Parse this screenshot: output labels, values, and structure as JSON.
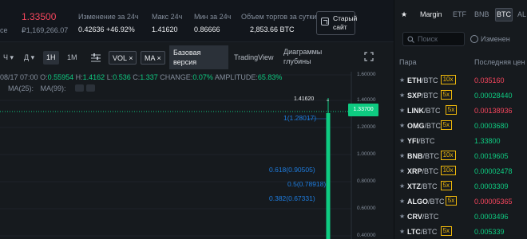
{
  "ticker": {
    "last_price": "1.33500",
    "fiat_price": "₽1,169,266.07",
    "pair_suffix": "ce",
    "change_label": "Изменение за 24ч",
    "change_value": "0.42636 +46.92%",
    "high_label": "Макс 24ч",
    "high_value": "1.41620",
    "low_label": "Мин за 24ч",
    "low_value": "0.86666",
    "volume_label": "Объем торгов за сутки",
    "volume_value": "2,853.66 BTC",
    "old_site_label_1": "Старый",
    "old_site_label_2": "сайт"
  },
  "toolbar": {
    "hours_label": "Ч",
    "days_label": "Д",
    "interval_1h": "1H",
    "interval_1m": "1M",
    "vol_label": "VOL",
    "ma_label": "MA",
    "close_glyph": "×",
    "dropdown_glyph": "▾",
    "base_version_1": "Базовая",
    "base_version_2": "версия",
    "tradingview_label": "TradingView",
    "depth_label_1": "Диаграммы",
    "depth_label_2": "глубины"
  },
  "chart": {
    "ohlc_date": "08/17 07:00",
    "o_label": "O:",
    "o_value": "0.55954",
    "h_label": "H:",
    "h_value": "1.4162",
    "l_label": "L:",
    "l_value": "0.536",
    "c_label": "C:",
    "c_value": "1.337",
    "change_label": "CHANGE:",
    "change_value": "0.07%",
    "amp_label": "AMPLITUDE:",
    "amp_value": "65.83%",
    "ma25_label": "MA(25):",
    "ma99_label": "MA(99):",
    "high_marker": "1.41620",
    "current_price_tag": "1.33700",
    "fib_1": "1(1.28017)",
    "fib_0618": "0.618(0.90505)",
    "fib_05": "0.5(0.78918)",
    "fib_0382": "0.382(0.67331)",
    "axis": [
      "1.60000",
      "1.40000",
      "1.20000",
      "1.00000",
      "0.80000",
      "0.60000",
      "0.40000"
    ]
  },
  "right_panel": {
    "star_glyph": "★",
    "tab_margin": "Margin",
    "tab_etf": "ETF",
    "tab_bnb": "BNB",
    "tab_btc": "BTC",
    "tab_alt": "AL",
    "search_placeholder": "Поиск",
    "change_toggle_label": "Изменен",
    "col_pair": "Пара",
    "col_price": "Последняя цен",
    "rows": [
      {
        "base": "ETH",
        "quote": "/BTC",
        "lev": "10x",
        "price": "0.035160",
        "color": "#f6465d"
      },
      {
        "base": "SXP",
        "quote": "/BTC",
        "lev": "5x",
        "price": "0.00028440",
        "color": "#0ecb81"
      },
      {
        "base": "LINK",
        "quote": "/BTC",
        "lev": "5x",
        "price": "0.00138936",
        "color": "#f6465d"
      },
      {
        "base": "OMG",
        "quote": "/BTC",
        "lev": "5x",
        "price": "0.0003680",
        "color": "#0ecb81"
      },
      {
        "base": "YFI",
        "quote": "/BTC",
        "lev": "",
        "price": "1.33800",
        "color": "#0ecb81"
      },
      {
        "base": "BNB",
        "quote": "/BTC",
        "lev": "10x",
        "price": "0.0019605",
        "color": "#0ecb81"
      },
      {
        "base": "XRP",
        "quote": "/BTC",
        "lev": "10x",
        "price": "0.00002478",
        "color": "#0ecb81"
      },
      {
        "base": "XTZ",
        "quote": "/BTC",
        "lev": "5x",
        "price": "0.0003309",
        "color": "#0ecb81"
      },
      {
        "base": "ALGO",
        "quote": "/BTC",
        "lev": "5x",
        "price": "0.00005365",
        "color": "#f6465d"
      },
      {
        "base": "CRV",
        "quote": "/BTC",
        "lev": "",
        "price": "0.0003496",
        "color": "#0ecb81"
      },
      {
        "base": "LTC",
        "quote": "/BTC",
        "lev": "5x",
        "price": "0.005339",
        "color": "#0ecb81"
      }
    ]
  },
  "colors": {
    "up": "#0ecb81",
    "down": "#f6465d",
    "accent": "#f0b90b",
    "fib": "#1e7de0"
  }
}
